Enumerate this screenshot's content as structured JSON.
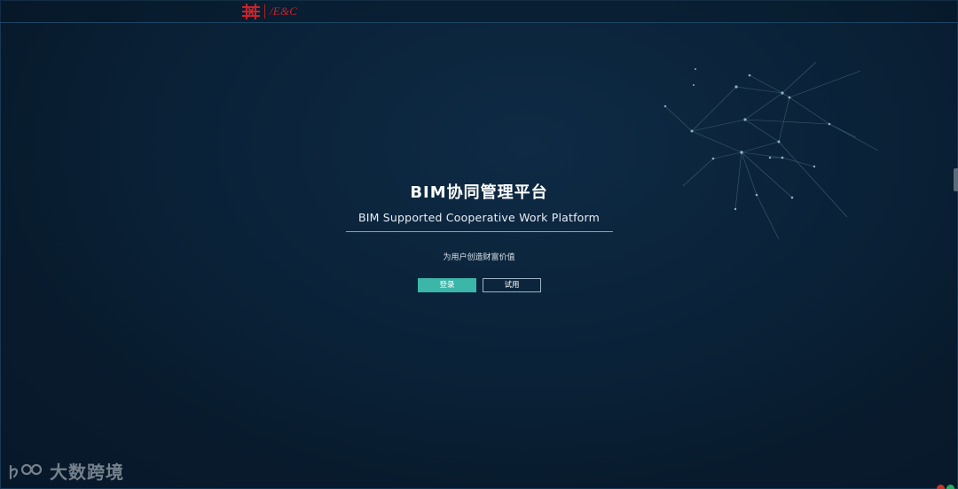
{
  "header": {
    "brand_text": "/E&C",
    "brand_color": "#c8232b"
  },
  "hero": {
    "title_cn": "BIM协同管理平台",
    "title_en": "BIM Supported Cooperative Work Platform",
    "slogan": "为用户创造财富价值"
  },
  "actions": {
    "login_label": "登录",
    "trial_label": "试用",
    "accent_color": "#3cb6a8"
  },
  "watermark": {
    "logo_text": "100",
    "text": "大数跨境"
  },
  "icons": {
    "brand_mark": "brand-logo-icon",
    "decoration": "network-constellation"
  }
}
